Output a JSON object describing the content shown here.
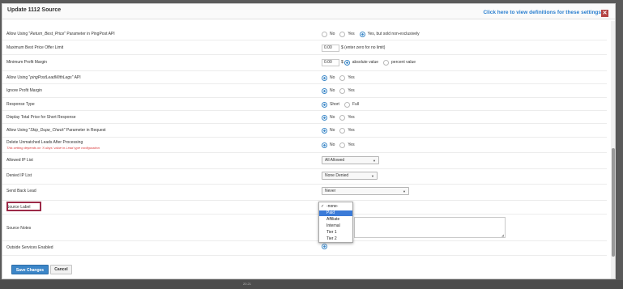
{
  "modal": {
    "title": "Update 1112 Source",
    "definitions_link": "Click here to view definitions for these settings",
    "close_glyph": "✕"
  },
  "rows": {
    "return_best_price": {
      "label_pre": "Allow Using \"",
      "label_em": "Return_Best_Price",
      "label_post": "\" Parameter in PingPost API",
      "options": [
        "No",
        "Yes",
        "Yes, but sold non-exclusively"
      ],
      "selected": "Yes, but sold non-exclusively"
    },
    "max_best_price": {
      "label": "Maximum Best Price Offer Limit",
      "value": "0.00",
      "suffix": "$ (enter zero for no limit)"
    },
    "min_profit_margin": {
      "label": "Minimum Profit Margin",
      "value": "0.00",
      "currency": "$",
      "options": [
        "absolute value",
        "percent value"
      ],
      "selected": "absolute value"
    },
    "ping_post_lead_with_legs": {
      "label_pre": "Allow Using \"",
      "label_em": "pingPostLeadWithLegs",
      "label_post": "\" API",
      "options": [
        "No",
        "Yes"
      ],
      "selected": "No"
    },
    "ignore_profit_margin": {
      "label": "Ignore Profit Margin",
      "options": [
        "No",
        "Yes"
      ],
      "selected": "No"
    },
    "response_type": {
      "label": "Response Type",
      "options": [
        "Short",
        "Full"
      ],
      "selected": "Short"
    },
    "display_total_price": {
      "label": "Display Total Price for Short Response",
      "options": [
        "No",
        "Yes"
      ],
      "selected": "No"
    },
    "skip_dupe_check": {
      "label_pre": "Allow Using \"",
      "label_em": "Skip_Dupe_Check",
      "label_post": "\" Parameter in Request",
      "options": [
        "No",
        "Yes"
      ],
      "selected": "No"
    },
    "delete_unmatched": {
      "label": "Delete Unmatched Leads After Processing",
      "note": "This setting depends on 'X days' value in Lead type configuration",
      "options": [
        "No",
        "Yes"
      ],
      "selected": "No"
    },
    "allowed_ip": {
      "label": "Allowed IP List",
      "value": "All Allowed"
    },
    "denied_ip": {
      "label": "Denied IP List",
      "value": "None Denied"
    },
    "send_back_lead": {
      "label": "Send Back Lead",
      "value": "Never"
    },
    "source_label": {
      "label": "Source Label",
      "options": [
        "-none-",
        "Paid",
        "Affiliate",
        "Internal",
        "Tier 1",
        "Tier 2"
      ],
      "checked": "-none-",
      "highlighted": "Paid"
    },
    "source_notes": {
      "label": "Source Notes",
      "value": ""
    },
    "outside_services": {
      "label": "Outside Services Enabled"
    }
  },
  "actions": {
    "save": "Save Changes",
    "cancel": "Cancel"
  },
  "glyphs": {
    "check": "✓",
    "caret": "▼",
    "resize": "◢"
  },
  "colors": {
    "accent": "#3b87c7",
    "link": "#2a7fd0",
    "close": "#b44444",
    "highlight_border": "#9c2a48",
    "note": "#d9383a",
    "dropdown_selected": "#3b7bd8"
  },
  "backdrop": {
    "footer_text": "20.21"
  }
}
